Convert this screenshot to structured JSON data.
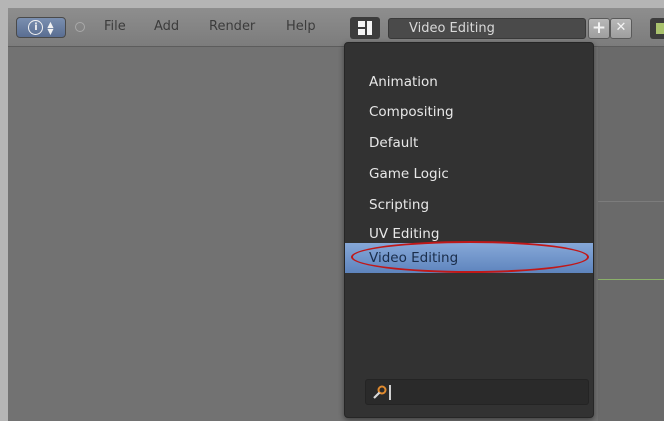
{
  "header": {
    "menus": [
      "File",
      "Add",
      "Render",
      "Help"
    ],
    "current_layout": "Video Editing",
    "add_button_glyph": "+",
    "remove_button_glyph": "✕",
    "info_glyph": "i",
    "icons": [
      "info-icon",
      "collapse-icon",
      "screen-layout-icon",
      "add-icon",
      "close-icon",
      "scene-icon"
    ]
  },
  "layout_menu": {
    "options": [
      "Animation",
      "Compositing",
      "Default",
      "Game Logic",
      "Scripting",
      "UV Editing",
      "Video Editing"
    ],
    "selected": "Video Editing",
    "search_value": ""
  },
  "colors": {
    "selection": "#6b8fc8",
    "annotation_ellipse": "#c01818",
    "menu_background": "#323232"
  }
}
